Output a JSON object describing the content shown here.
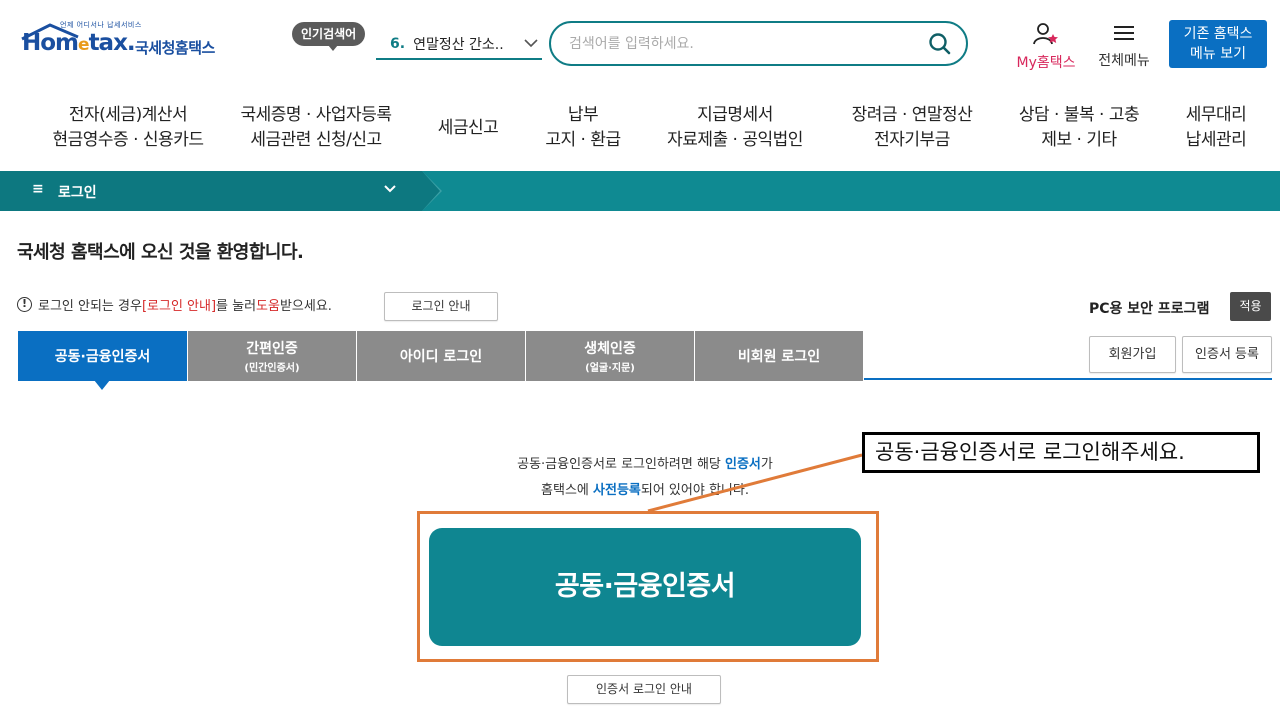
{
  "header": {
    "logo_tagline": "언제 어디서나 납세서비스",
    "logo_word_a": "Hom",
    "logo_word_e": "e",
    "logo_word_b": "tax.",
    "logo_kor": "국세청홈택스",
    "popular_badge": "인기검색어",
    "popular_num": "6.",
    "popular_text": "연말정산 간소..",
    "search_placeholder": "검색어를 입력하세요.",
    "my_hometax": "My홈택스",
    "all_menu": "전체메뉴",
    "old_menu_line1": "기존 홈택스",
    "old_menu_line2": "메뉴 보기",
    "accent_color": "#0f7c85"
  },
  "gnb": [
    {
      "line1": "전자(세금)계산서",
      "line2": "현금영수증 · 신용카드"
    },
    {
      "line1": "국세증명 · 사업자등록",
      "line2": "세금관련 신청/신고"
    },
    {
      "line1": "세금신고",
      "line2": ""
    },
    {
      "line1": "납부",
      "line2": "고지 · 환급"
    },
    {
      "line1": "지급명세서",
      "line2": "자료제출 · 공익법인"
    },
    {
      "line1": "장려금 · 연말정산",
      "line2": "전자기부금"
    },
    {
      "line1": "상담 · 불복 · 고충",
      "line2": "제보 · 기타"
    },
    {
      "line1": "세무대리",
      "line2": "납세관리"
    }
  ],
  "location": {
    "current": "로그인"
  },
  "content": {
    "welcome": "국세청 홈택스에 오신 것을 환영합니다.",
    "notice_prefix": "로그인 안되는 경우 ",
    "notice_red1": "[로그인 안내]",
    "notice_mid": "를 눌러 ",
    "notice_red2": "도움",
    "notice_suffix": "받으세요.",
    "notice_button": "로그인 안내",
    "pc_security": "PC용 보안 프로그램",
    "apply_button": "적용",
    "join_button": "회원가입",
    "cert_register_button": "인증서 등록"
  },
  "tabs": [
    {
      "label": "공동·금융인증서",
      "sub": "",
      "active": true
    },
    {
      "label": "간편인증",
      "sub": "(민간인증서)",
      "active": false
    },
    {
      "label": "아이디 로그인",
      "sub": "",
      "active": false
    },
    {
      "label": "생체인증",
      "sub": "(얼굴·지문)",
      "active": false
    },
    {
      "label": "비회원 로그인",
      "sub": "",
      "active": false
    }
  ],
  "cert_panel": {
    "guide_a": "공동·금융인증서로 로그인하려면 해당 ",
    "guide_b": "인증서",
    "guide_c": "가",
    "guide_d": "홈택스에 ",
    "guide_e": "사전등록",
    "guide_f": "되어 있어야 합니다.",
    "main_button": "공동·금융인증서",
    "cert_guide_button": "인증서 로그인 안내"
  },
  "annotation": {
    "callout": "공동·금융인증서로 로그인해주세요.",
    "highlight_color": "#e07b39"
  }
}
